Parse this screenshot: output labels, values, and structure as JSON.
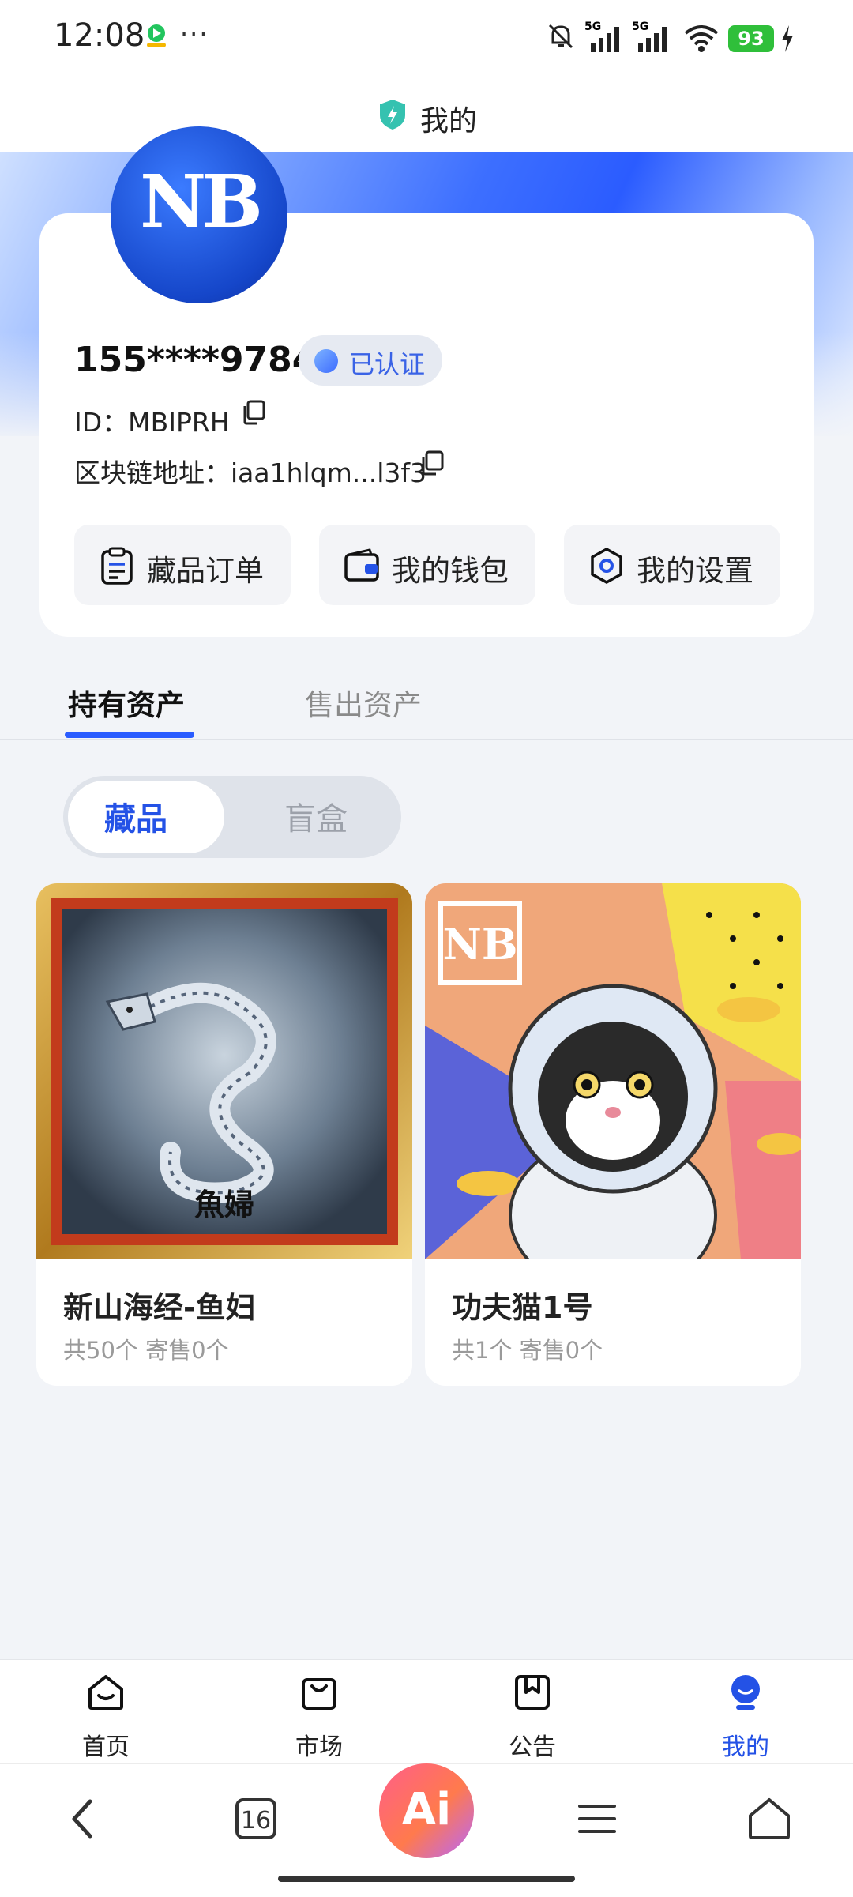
{
  "status_bar": {
    "time": "12:08",
    "more": "···",
    "battery": "93",
    "network": "5G"
  },
  "header": {
    "title": "我的"
  },
  "profile": {
    "avatar_text": "NB",
    "phone": "155****9784",
    "verified_label": "已认证",
    "id_label": "ID：",
    "id_value": "MBIPRH",
    "address_label": "区块链地址：",
    "address_value": "iaa1hlqm...l3f3"
  },
  "quick_actions": [
    {
      "label": "藏品订单",
      "icon": "clipboard-icon"
    },
    {
      "label": "我的钱包",
      "icon": "wallet-icon"
    },
    {
      "label": "我的设置",
      "icon": "settings-icon"
    }
  ],
  "tabs": [
    {
      "label": "持有资产",
      "active": true
    },
    {
      "label": "售出资产",
      "active": false
    }
  ],
  "segments": [
    {
      "label": "藏品",
      "active": true
    },
    {
      "label": "盲盒",
      "active": false
    }
  ],
  "collectibles": [
    {
      "title": "新山海经-鱼妇",
      "meta": "共50个 寄售0个",
      "art_text": "魚婦"
    },
    {
      "title": "功夫猫1号",
      "meta": "共1个 寄售0个",
      "art_text": "NB"
    }
  ],
  "bottom_nav": [
    {
      "label": "首页",
      "icon": "home-smile-icon",
      "active": false
    },
    {
      "label": "市场",
      "icon": "shopping-bag-icon",
      "active": false
    },
    {
      "label": "公告",
      "icon": "bookmark-icon",
      "active": false
    },
    {
      "label": "我的",
      "icon": "user-icon",
      "active": true
    }
  ],
  "system_nav": {
    "tabs_count": "16",
    "ai_label": "Ai"
  },
  "colors": {
    "accent": "#2452e6",
    "tab_underline": "#2a5cff",
    "battery": "#2fbf3a"
  }
}
